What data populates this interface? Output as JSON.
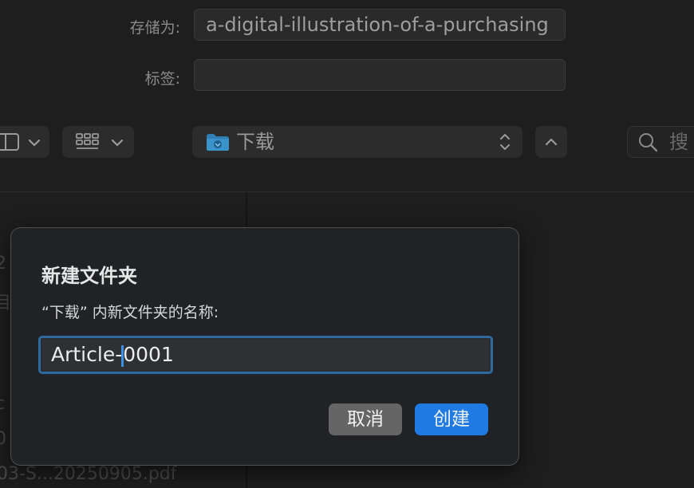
{
  "save_panel": {
    "save_as_label": "存储为:",
    "save_as_value": "a-digital-illustration-of-a-purchasing",
    "tags_label": "标签:",
    "tags_value": "",
    "location": "下载",
    "search_placeholder": "搜",
    "icons": {
      "sidebar_toggle": "sidebar-icon",
      "view_mode": "grid-icon",
      "location_folder": "downloads-folder-icon",
      "location_stepper": "up-down-chevron-icon",
      "collapse": "chevron-up-icon",
      "search": "search-icon"
    }
  },
  "background_list": {
    "fragments": [
      "2",
      "目",
      "c",
      "0",
      "03-S...20250905.pdf"
    ]
  },
  "dialog": {
    "title": "新建文件夹",
    "prompt": "“下载” 内新文件夹的名称:",
    "input_before_caret": "Article-",
    "input_after_caret": "0001",
    "cancel_label": "取消",
    "create_label": "创建"
  },
  "colors": {
    "accent": "#1f7be3",
    "focus_ring": "#2f6a9e",
    "dialog_bg": "#202225",
    "window_bg": "#1e1e1e"
  }
}
